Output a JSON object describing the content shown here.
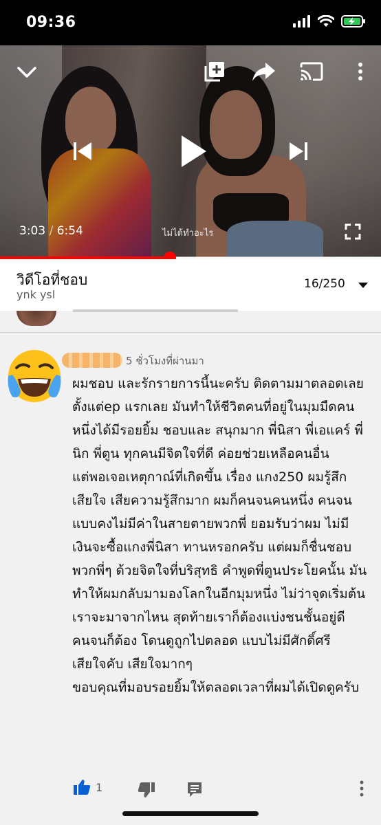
{
  "status": {
    "time": "09:36"
  },
  "player": {
    "current_time": "3:03",
    "separator": "/",
    "duration": "6:54",
    "caption": "ไม่ได้ทำอะไร",
    "progress": 0.445,
    "accent_color": "#ff0000"
  },
  "playlist": {
    "title": "วิดีโอที่ชอบ",
    "channel": "ynk ysl",
    "position": "16/250"
  },
  "comment": {
    "avatar_icon": "face-with-tears-of-joy-emoji",
    "time": "5 ชั่วโมงที่ผ่านมา",
    "paragraphs": [
      "ผมชอบ และรักรายการนี้นะครับ ติดตามมาตลอดเลย ตั้งแต่ep แรกเลย มันทำให้ชีวิตคนที่อยู่ในมุมมืดคนหนึ่งได้มีรอยยิ้ม ชอบและ สนุกมาก  พี่นิสา พี่เอแคร์ พี่นิก พี่ตูน  ทุกคนมีจิตใจที่ดี ค่อยช่วยเหลือคนอื่น",
      "แต่พอเจอเหตุกาณ์ที่เกิดขึ้น เรื่อง แกง250 ผมรู้สึกเสียใจ เสียความรู้สึกมาก ผมก็คนจนคนหนึ่ง คนจนแบบคงไม่มีค่าในสายตายพวกพี่ ยอมรับว่าผม ไม่มีเงินจะซื้อแกงพี่นิสา ทานหรอกครับ แต่ผมก็ชื่นชอบพวกพี่ๆ ด้วยจิตใจที่บริสุทธิ คำพูดพี่ตูนประโยคนั้น มันทำให้ผมกลับมามองโลกในอีกมุมหนึ่ง ไม่ว่าจุดเริ่มต้นเราจะมาจากไหน สุดท้ายเราก็ต้องแบ่งชนชั้นอยู่ดี คนจนก็ต้อง โดนดูถูกไปตลอด แบบไม่มีศักดิ์ศรี",
      "เสียใจคับ เสียใจมากๆ",
      "ขอบคุณที่มอบรอยยิ้มให้ตลอดเวลาที่ผมได้เปิดดูครับ"
    ],
    "like_count": "1",
    "like_color": "#065fd4"
  }
}
